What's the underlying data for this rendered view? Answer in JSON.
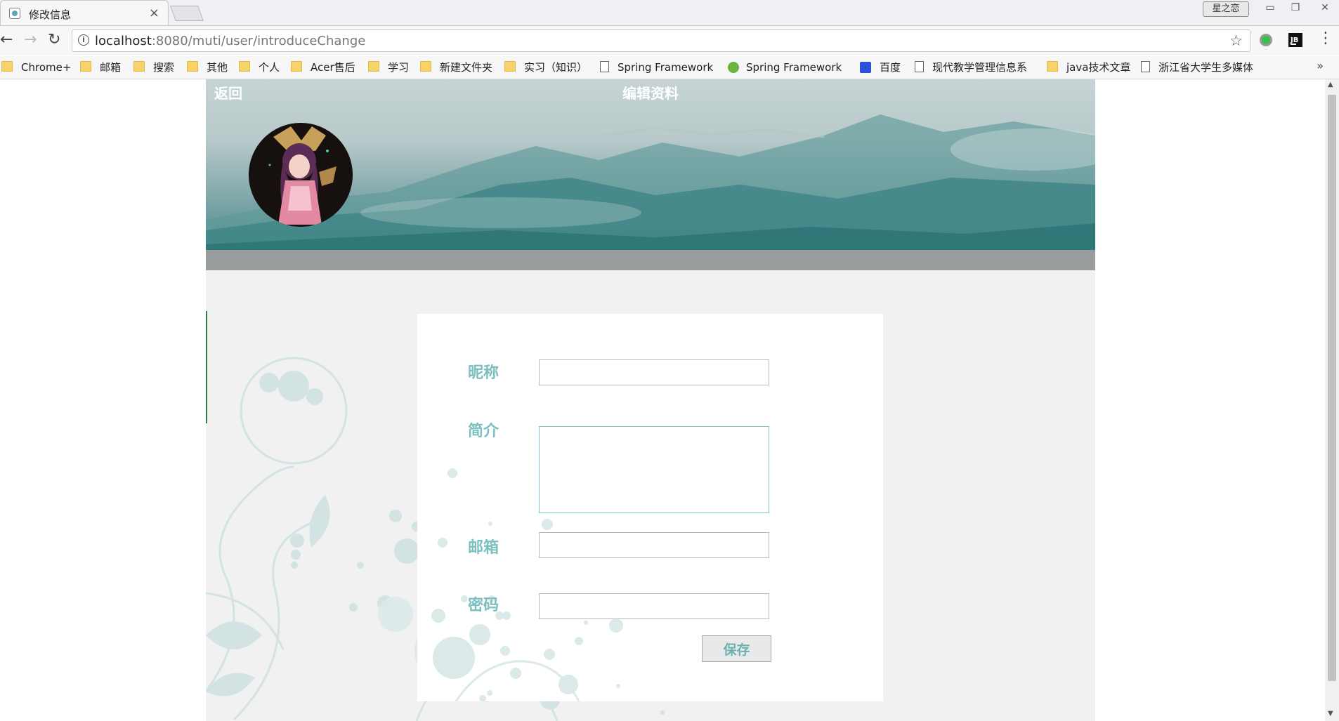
{
  "browser": {
    "tab_title": "修改信息",
    "tab_close": "×",
    "window_user": "星之恋",
    "url_host": "localhost",
    "url_rest": ":8080/muti/user/introduceChange",
    "bookmarks": [
      {
        "label": "Chrome+",
        "icon": "folder-icon"
      },
      {
        "label": "邮箱",
        "icon": "folder-icon"
      },
      {
        "label": "搜索",
        "icon": "folder-icon"
      },
      {
        "label": "其他",
        "icon": "folder-icon"
      },
      {
        "label": "个人",
        "icon": "folder-icon"
      },
      {
        "label": "Acer售后",
        "icon": "folder-icon"
      },
      {
        "label": "学习",
        "icon": "folder-icon"
      },
      {
        "label": "新建文件夹",
        "icon": "folder-icon"
      },
      {
        "label": "实习（知识）",
        "icon": "folder-icon"
      },
      {
        "label": "Spring Framework",
        "icon": "page-icon"
      },
      {
        "label": "Spring Framework",
        "icon": "spring-leaf-icon"
      },
      {
        "label": "百度",
        "icon": "baidu-paw-icon"
      },
      {
        "label": "现代教学管理信息系",
        "icon": "page-icon"
      },
      {
        "label": "java技术文章",
        "icon": "folder-icon"
      },
      {
        "label": "浙江省大学生多媒体",
        "icon": "page-icon"
      }
    ],
    "bookmarks_more": "»"
  },
  "header": {
    "back_label": "返回",
    "title": "编辑资料"
  },
  "form": {
    "nickname_label": "昵称",
    "nickname_value": "",
    "intro_label": "简介",
    "intro_value": "",
    "email_label": "邮箱",
    "email_value": "",
    "password_label": "密码",
    "password_value": "",
    "save_label": "保存"
  },
  "colors": {
    "label": "#7bbfc0",
    "page_bg": "#f1f1f1",
    "grey_bar": "#999c9d"
  }
}
